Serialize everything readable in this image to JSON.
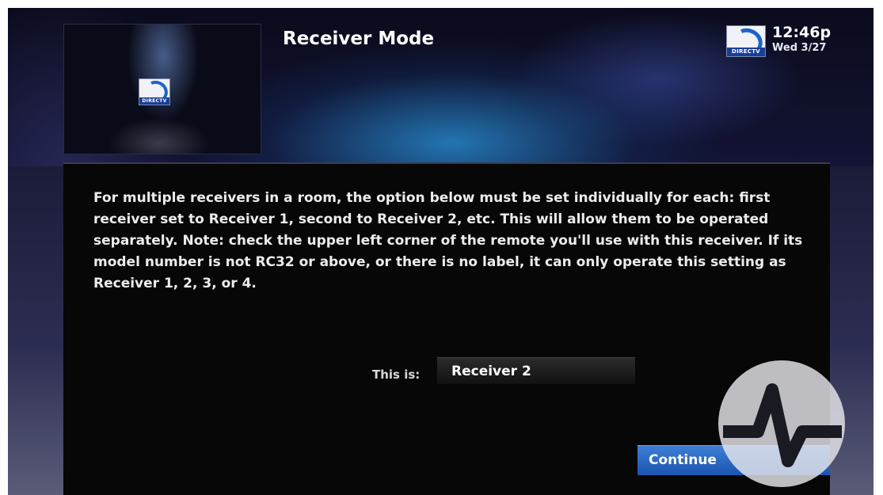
{
  "header": {
    "title": "Receiver Mode",
    "time": "12:46p",
    "date": "Wed 3/27",
    "logo_text": "DIRECTV",
    "logo_icon": "directv-logo-icon"
  },
  "preview": {
    "logo_text": "DIRECTV",
    "logo_icon": "directv-logo-icon"
  },
  "main": {
    "instructions": "For multiple receivers in a room, the option below must be set individually for each: first receiver set to Receiver 1, second to Receiver 2, etc.  This will allow them to be operated separately.  Note: check the upper left corner of the remote you'll use with this receiver.  If its model number is not RC32 or above, or there is no label, it can only operate this setting as Receiver 1, 2, 3, or 4.",
    "receiver_label": "This is:",
    "receiver_value": "Receiver 2",
    "continue_label": "Continue"
  },
  "watermark": {
    "icon": "pulse-watermark-icon"
  },
  "colors": {
    "accent": "#2a6ccb",
    "panel_bg": "#070707",
    "text": "#ececec"
  }
}
